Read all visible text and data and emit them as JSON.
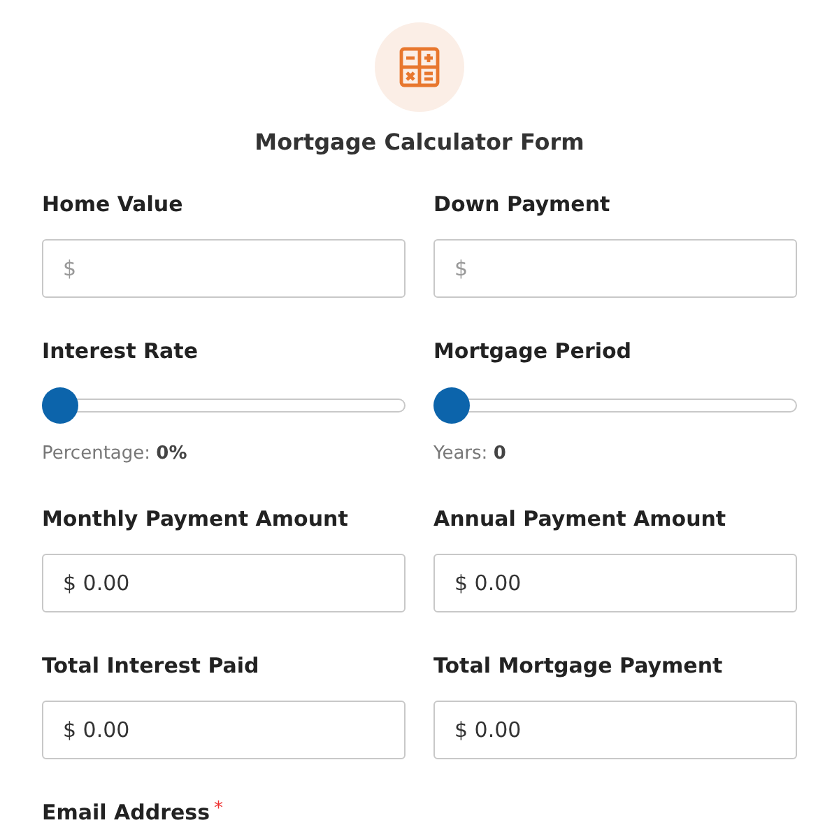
{
  "form": {
    "title": "Mortgage Calculator Form"
  },
  "fields": [
    {
      "kind": "input",
      "label": "Home Value",
      "placeholder": "$"
    },
    {
      "kind": "input",
      "label": "Down Payment",
      "placeholder": "$"
    },
    {
      "kind": "slider",
      "label": "Interest Rate",
      "level": 0,
      "caption": "Percentage: **0%**"
    },
    {
      "kind": "slider",
      "label": "Mortgage Period",
      "level": 0,
      "caption": "Years: **0**"
    },
    {
      "kind": "input",
      "label": "Monthly Payment Amount",
      "value": "$ 0.00"
    },
    {
      "kind": "input",
      "label": "Annual Payment Amount",
      "value": "$ 0.00"
    },
    {
      "kind": "input",
      "label": "Total Interest Paid",
      "value": "$ 0.00"
    },
    {
      "kind": "input",
      "label": "Total Mortgage Payment",
      "value": "$ 0.00"
    },
    {
      "kind": "label",
      "label": "Email Address",
      "required_mark": "*"
    }
  ]
}
